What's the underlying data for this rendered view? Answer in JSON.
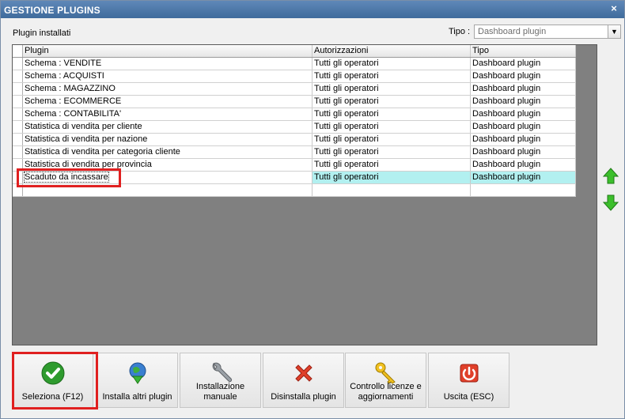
{
  "window": {
    "title": "GESTIONE PLUGINS",
    "close_glyph": "×"
  },
  "labels": {
    "installed": "Plugin installati",
    "tipo": "Tipo :"
  },
  "tipo_select": {
    "value": "Dashboard plugin",
    "arrow_icon": "chevron-down-icon"
  },
  "table": {
    "columns": [
      "Plugin",
      "Autorizzazioni",
      "Tipo"
    ],
    "rows": [
      [
        "Schema : VENDITE",
        "Tutti gli operatori",
        "Dashboard plugin"
      ],
      [
        "Schema : ACQUISTI",
        "Tutti gli operatori",
        "Dashboard plugin"
      ],
      [
        "Schema : MAGAZZINO",
        "Tutti gli operatori",
        "Dashboard plugin"
      ],
      [
        "Schema : ECOMMERCE",
        "Tutti gli operatori",
        "Dashboard plugin"
      ],
      [
        "Schema : CONTABILITA'",
        "Tutti gli operatori",
        "Dashboard plugin"
      ],
      [
        "Statistica di vendita per cliente",
        "Tutti gli operatori",
        "Dashboard plugin"
      ],
      [
        "Statistica di vendita per nazione",
        "Tutti gli operatori",
        "Dashboard plugin"
      ],
      [
        "Statistica di vendita per categoria cliente",
        "Tutti gli operatori",
        "Dashboard plugin"
      ],
      [
        "Statistica di vendita per provincia",
        "Tutti gli operatori",
        "Dashboard plugin"
      ],
      [
        "Scaduto da incassare",
        "Tutti gli operatori",
        "Dashboard plugin"
      ]
    ],
    "selected_row": 9
  },
  "side_buttons": {
    "up_icon": "arrow-up-icon",
    "down_icon": "arrow-down-icon"
  },
  "toolbar": {
    "select": "Seleziona (F12)",
    "install_more": "Installa altri plugin",
    "manual_install_1": "Installazione",
    "manual_install_2": "manuale",
    "uninstall": "Disinstalla plugin",
    "license_1": "Controllo licenze e",
    "license_2": "aggiornamenti",
    "exit": "Uscita (ESC)"
  },
  "colors": {
    "title_bar": "#4a76a8",
    "selected_row": "#b2f0f0",
    "highlight": "#e02020",
    "check_green": "#2e9b2e",
    "arrow_green": "#3cbf2c"
  }
}
